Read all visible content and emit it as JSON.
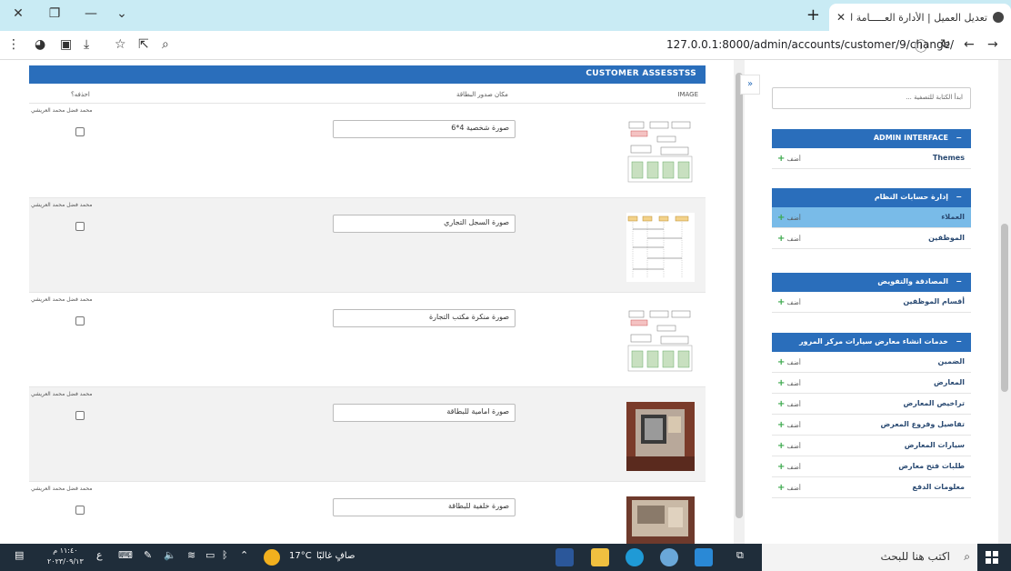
{
  "browser": {
    "tab_title": "تعديل العميل | الأدارة العـــــامة للـ...",
    "url": "127.0.0.1:8000/admin/accounts/customer/9/change/"
  },
  "main": {
    "module_title": "CUSTOMER ASSESSTSS",
    "columns": {
      "image": "IMAGE",
      "card_place": "مكان صدور البطاقة",
      "delete": "احذفه؟"
    },
    "rows": [
      {
        "owner": "محمد فضل محمد العريشي",
        "card_place": "صورة شخصية 4*6",
        "thumb": "diagram"
      },
      {
        "owner": "محمد فضل محمد العريشي",
        "card_place": "صورة السجل التجاري",
        "thumb": "sequence"
      },
      {
        "owner": "محمد فضل محمد العريشي",
        "card_place": "صورة منكرة مكتب التجارة",
        "thumb": "diagram"
      },
      {
        "owner": "محمد فضل محمد العريشي",
        "card_place": "صورة امامية للبطاقة",
        "thumb": "photo"
      },
      {
        "owner": "محمد فضل محمد العريشي",
        "card_place": "صورة خلفية للبطاقة",
        "thumb": "photo2"
      }
    ]
  },
  "sidebar": {
    "search_placeholder": "ابدأ الكتابة للتصفية ...",
    "groups": [
      {
        "title": "ADMIN INTERFACE",
        "items": [
          {
            "name": "Themes",
            "add": "أضف"
          }
        ]
      },
      {
        "title": "إدارة حسابات النظام",
        "items": [
          {
            "name": "العملاء",
            "add": "أضف",
            "active": true
          },
          {
            "name": "الموظفين",
            "add": "أضف"
          }
        ]
      },
      {
        "title": "المصادقة والتفويض",
        "items": [
          {
            "name": "أقسام الموظفين",
            "add": "أضف"
          }
        ]
      },
      {
        "title": "خدمات انشاء معارض سيارات مركز المرور",
        "items": [
          {
            "name": "الضمين",
            "add": "أضف"
          },
          {
            "name": "المعارض",
            "add": "أضف"
          },
          {
            "name": "تراخيص المعارض",
            "add": "أضف"
          },
          {
            "name": "تفاصيل وفروع المعرض",
            "add": "أضف"
          },
          {
            "name": "سيارات المعارض",
            "add": "أضف"
          },
          {
            "name": "طلبات فتح معارض",
            "add": "أضف"
          },
          {
            "name": "معلومات الدفع",
            "add": "أضف"
          }
        ]
      }
    ]
  },
  "taskbar": {
    "search_text": "اكتب هنا للبحث",
    "weather_temp": "17°C",
    "weather_text": "صافٍ غالبًا",
    "time": "١١:٤٠ م",
    "date": "٢٠٢٣/٠٩/١٣",
    "lang": "ع"
  },
  "colors": {
    "accent": "#2a6ebb",
    "active_item": "#79bbe8",
    "add_plus": "#3aa84b"
  }
}
